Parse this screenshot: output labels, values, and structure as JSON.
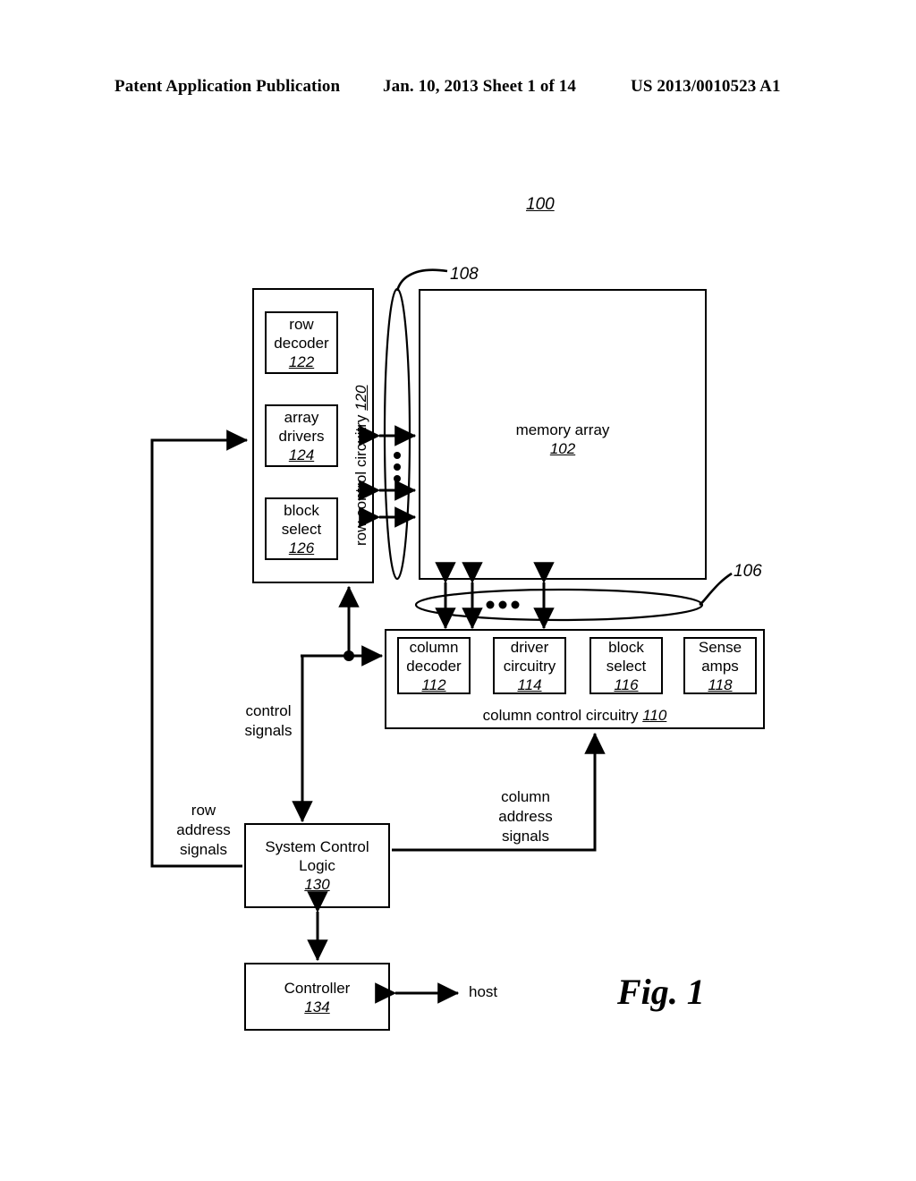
{
  "header": {
    "publication": "Patent Application Publication",
    "date_sheet": "Jan. 10, 2013  Sheet 1 of 14",
    "patent_number": "US 2013/0010523 A1"
  },
  "figure": {
    "caption": "Fig. 1",
    "system_ref": "100"
  },
  "memory_array": {
    "label": "memory array",
    "ref": "102"
  },
  "row_control": {
    "label": "row control circuitry",
    "ref": "120",
    "units": [
      {
        "line1": "row",
        "line2": "decoder",
        "ref": "122"
      },
      {
        "line1": "array",
        "line2": "drivers",
        "ref": "124"
      },
      {
        "line1": "block",
        "line2": "select",
        "ref": "126"
      }
    ]
  },
  "column_control": {
    "label": "column control circuitry",
    "ref": "110",
    "units": [
      {
        "line1": "column",
        "line2": "decoder",
        "ref": "112"
      },
      {
        "line1": "driver",
        "line2": "circuitry",
        "ref": "114"
      },
      {
        "line1": "block",
        "line2": "select",
        "ref": "116"
      },
      {
        "line1": "Sense",
        "line2": "amps",
        "ref": "118"
      }
    ]
  },
  "system_control": {
    "line1": "System Control",
    "line2": "Logic",
    "ref": "130"
  },
  "controller": {
    "label": "Controller",
    "ref": "134"
  },
  "host": {
    "label": "host"
  },
  "buses": {
    "row_bus_ref": "108",
    "column_bus_ref": "106"
  },
  "signals": {
    "control": {
      "line1": "control",
      "line2": "signals"
    },
    "row_address": {
      "line1": "row",
      "line2": "address",
      "line3": "signals"
    },
    "column_address": {
      "line1": "column",
      "line2": "address",
      "line3": "signals"
    }
  },
  "colors": {
    "ink": "#000000",
    "paper": "#ffffff"
  }
}
